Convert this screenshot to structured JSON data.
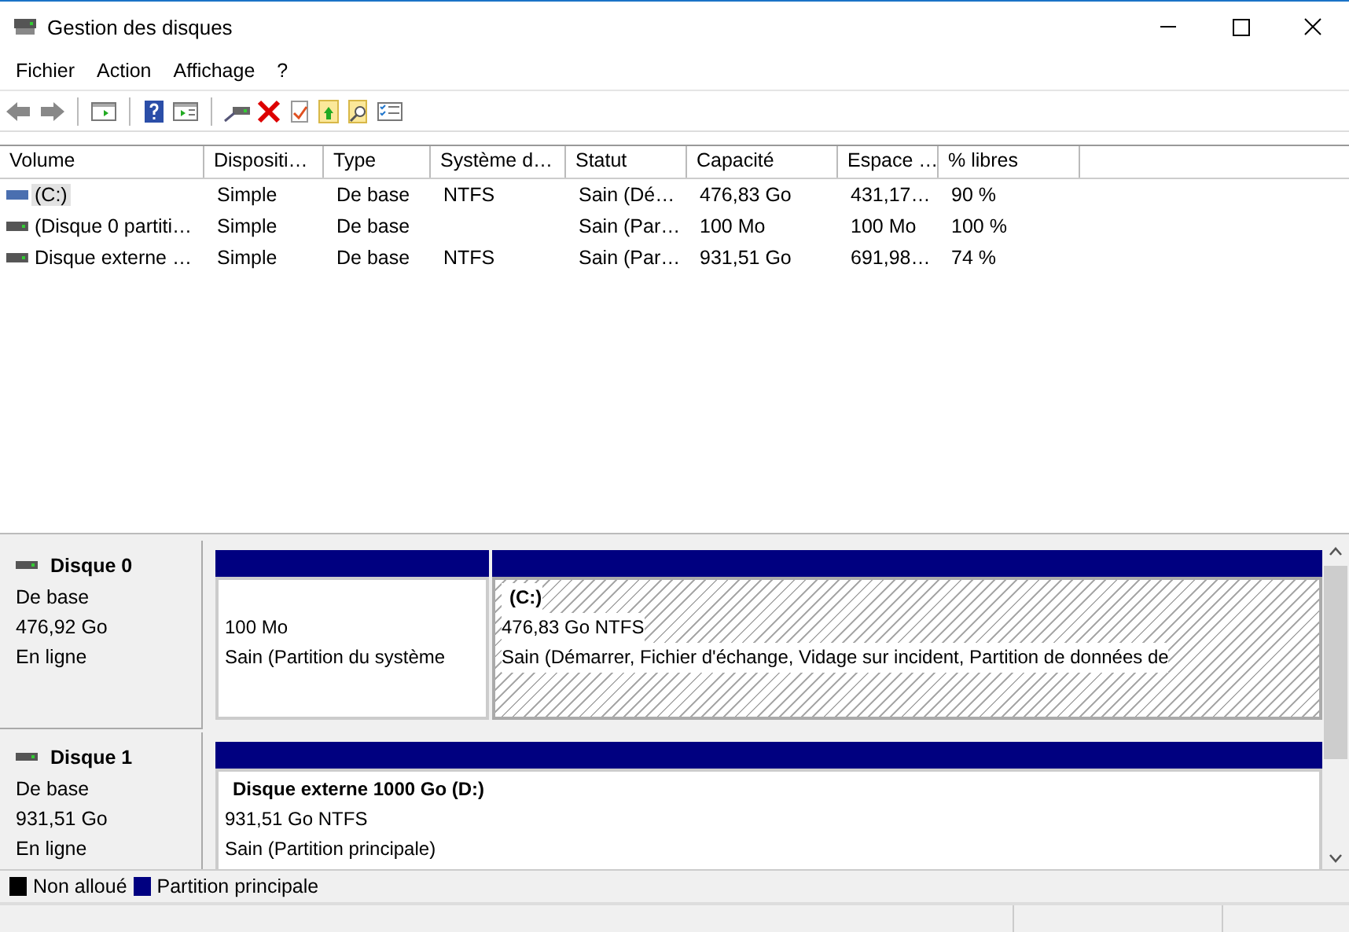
{
  "window": {
    "title": "Gestion des disques"
  },
  "menu": [
    "Fichier",
    "Action",
    "Affichage",
    "?"
  ],
  "table": {
    "columns": [
      "Volume",
      "Dispositi…",
      "Type",
      "Système d…",
      "Statut",
      "Capacité",
      "Espace …",
      "% libres"
    ],
    "rows": [
      {
        "selected": true,
        "cells": [
          "(C:)",
          "Simple",
          "De base",
          "NTFS",
          "Sain (Dé…",
          "476,83 Go",
          "431,17…",
          "90 %"
        ]
      },
      {
        "selected": false,
        "cells": [
          "(Disque 0 partiti…",
          "Simple",
          "De base",
          "",
          "Sain (Par…",
          "100 Mo",
          "100 Mo",
          "100 %"
        ]
      },
      {
        "selected": false,
        "cells": [
          "Disque externe …",
          "Simple",
          "De base",
          "NTFS",
          "Sain (Par…",
          "931,51 Go",
          "691,98…",
          "74 %"
        ]
      }
    ]
  },
  "disks": [
    {
      "name": "Disque 0",
      "type": "De base",
      "size": "476,92 Go",
      "status": "En ligne",
      "partitions": [
        {
          "selected": false,
          "size": "100 Mo",
          "status": "Sain (Partition du système"
        },
        {
          "selected": true,
          "name": "(C:)",
          "size": "476,83 Go NTFS",
          "status": "Sain (Démarrer, Fichier d'échange, Vidage sur incident, Partition de données de"
        }
      ]
    },
    {
      "name": "Disque 1",
      "type": "De base",
      "size": "931,51 Go",
      "status": "En ligne",
      "partitions": [
        {
          "selected": false,
          "name": "Disque externe 1000 Go  (D:)",
          "size": "931,51 Go NTFS",
          "status": "Sain (Partition principale)"
        }
      ]
    }
  ],
  "legend": [
    {
      "label": "Non alloué",
      "color": "#000000"
    },
    {
      "label": "Partition principale",
      "color": "#000080"
    }
  ]
}
